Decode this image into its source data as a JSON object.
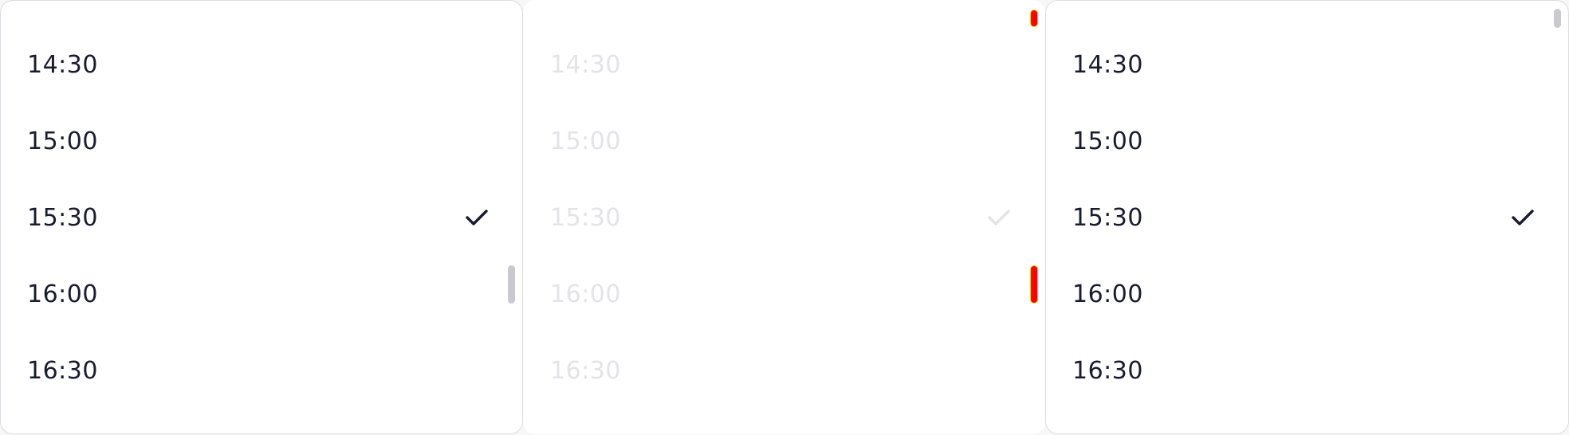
{
  "panels": [
    {
      "state": "default",
      "items": [
        "14:30",
        "15:00",
        "15:30",
        "16:00",
        "16:30"
      ],
      "selected_value": "15:30",
      "check_icon": "check-icon",
      "scroll_position": 0.45
    },
    {
      "state": "disabled",
      "items": [
        "14:30",
        "15:00",
        "15:30",
        "16:00",
        "16:30"
      ],
      "selected_value": "15:30",
      "check_icon": "check-icon",
      "scroll_position": 0.45
    },
    {
      "state": "default",
      "items": [
        "14:30",
        "15:00",
        "15:30",
        "16:00",
        "16:30"
      ],
      "selected_value": "15:30",
      "check_icon": "check-icon",
      "scroll_position": 0.0
    }
  ],
  "colors": {
    "text": "#1a1b2f",
    "disabled_text": "#e4e4e8",
    "border": "#dddde2",
    "scroll_thumb": "#c9c9cf",
    "disabled_scroll_thumb": "#ff0000"
  }
}
